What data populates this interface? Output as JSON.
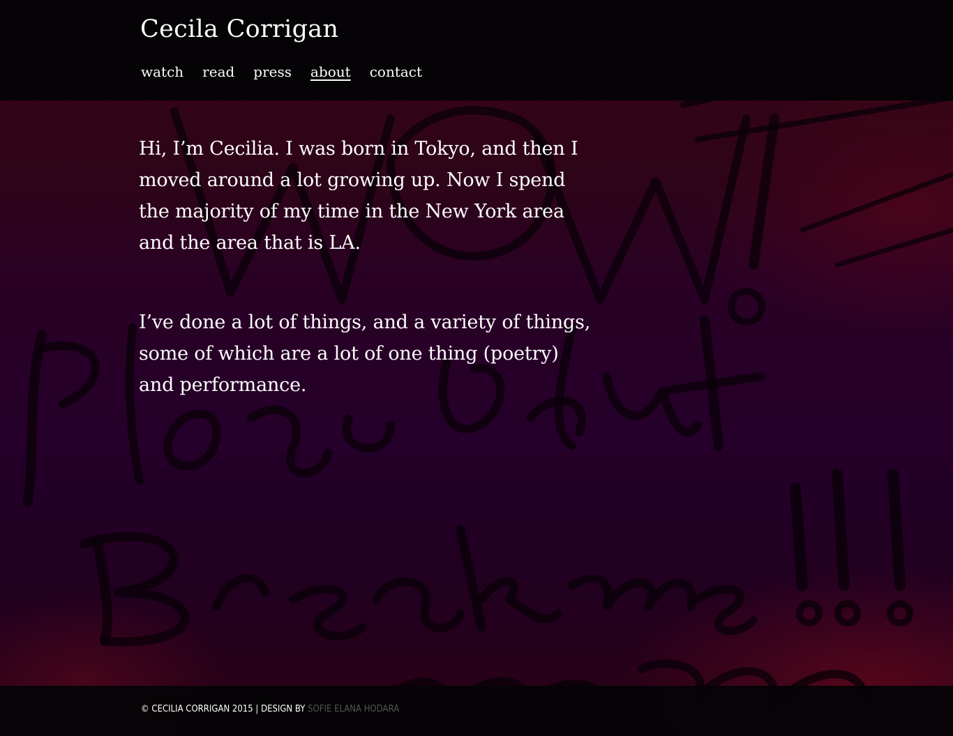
{
  "site": {
    "title": "Cecila Corrigan"
  },
  "nav": {
    "items": [
      {
        "label": "watch",
        "active": false
      },
      {
        "label": "read",
        "active": false
      },
      {
        "label": "press",
        "active": false
      },
      {
        "label": "about",
        "active": true
      },
      {
        "label": "contact",
        "active": false
      }
    ]
  },
  "content": {
    "paragraphs": [
      "Hi, I’m Cecilia. I was born in Tokyo, and then I moved around a lot growing up. Now I spend the majority of my time in the New York area and the area that is LA.",
      "I’ve done a lot of things, and a variety of things, some of which are a lot of one thing (poetry) and performance."
    ]
  },
  "footer": {
    "copyright": "© CECILIA CORRIGAN 2015 | DESIGN BY ",
    "designer_link": "SOFIE ELANA HODARA"
  },
  "colors": {
    "header_bg": "#050306",
    "text": "#ffffff",
    "footer_link": "#555555"
  }
}
